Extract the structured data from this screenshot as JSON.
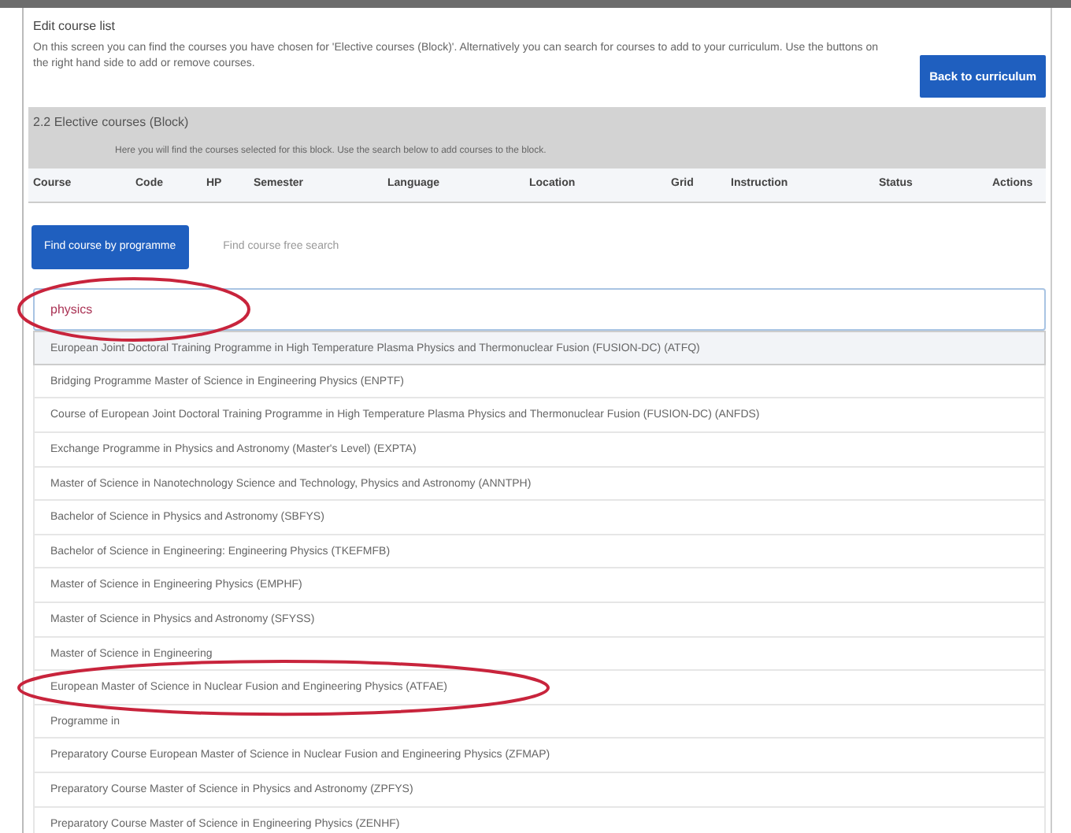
{
  "panel": {
    "title": "Edit course list",
    "description": "On this screen you can find the courses you have chosen for 'Elective courses (Block)'. Alternatively you can search for courses to add to your curriculum. Use the buttons on the right hand side to add or remove courses.",
    "back_button": "Back to curriculum"
  },
  "section": {
    "title": "2.2 Elective courses (Block)",
    "note": "Here you will find the courses selected for this block. Use the search below to add courses to the block."
  },
  "table": {
    "columns": [
      "Course",
      "Code",
      "HP",
      "Semester",
      "Language",
      "Location",
      "Grid",
      "Instruction",
      "Status",
      "Actions"
    ]
  },
  "tabs": [
    {
      "label": "Find course by programme",
      "selected": true
    },
    {
      "label": "Find course free search",
      "selected": false
    }
  ],
  "search": {
    "value": "physics",
    "circled": true
  },
  "results": [
    {
      "label": "European Joint Doctoral Training Programme in High Temperature Plasma Physics and Thermonuclear Fusion (FUSION-DC) (ATFQ)",
      "highlighted": true,
      "circled": false
    },
    {
      "label": "Bridging Programme Master of Science in Engineering Physics (ENPTF)",
      "highlighted": false
    },
    {
      "label": "Course of European Joint Doctoral Training Programme in High Temperature Plasma Physics and Thermonuclear Fusion (FUSION-DC) (ANFDS)",
      "highlighted": false
    },
    {
      "label": "Exchange Programme in Physics and Astronomy (Master's Level) (EXPTA)",
      "highlighted": false
    },
    {
      "label": "Master of Science in Nanotechnology Science and Technology, Physics and Astronomy (ANNTPH)",
      "highlighted": false
    },
    {
      "label": "Bachelor of Science in Physics and Astronomy (SBFYS)",
      "highlighted": false
    },
    {
      "label": "Bachelor of Science in Engineering: Engineering Physics (TKEFMFB)",
      "highlighted": false
    },
    {
      "label": "Master of Science in Engineering Physics (EMPHF)",
      "highlighted": false
    },
    {
      "label": "Master of Science in Physics and Astronomy (SFYSS)",
      "highlighted": false
    },
    {
      "label": "Master of Science in Engineering",
      "highlighted": false
    },
    {
      "label": "European Master of Science in Nuclear Fusion and Engineering Physics (ATFAE)",
      "highlighted": false,
      "circled": true
    },
    {
      "label": "Programme in",
      "highlighted": false
    },
    {
      "label": "Preparatory Course European Master of Science in Nuclear Fusion and Engineering Physics (ZFMAP)",
      "highlighted": false
    },
    {
      "label": "Preparatory Course Master of Science in Physics and Astronomy (ZPFYS)",
      "highlighted": false
    },
    {
      "label": "Preparatory Course Master of Science in Engineering Physics (ZENHF)",
      "highlighted": false
    }
  ]
}
